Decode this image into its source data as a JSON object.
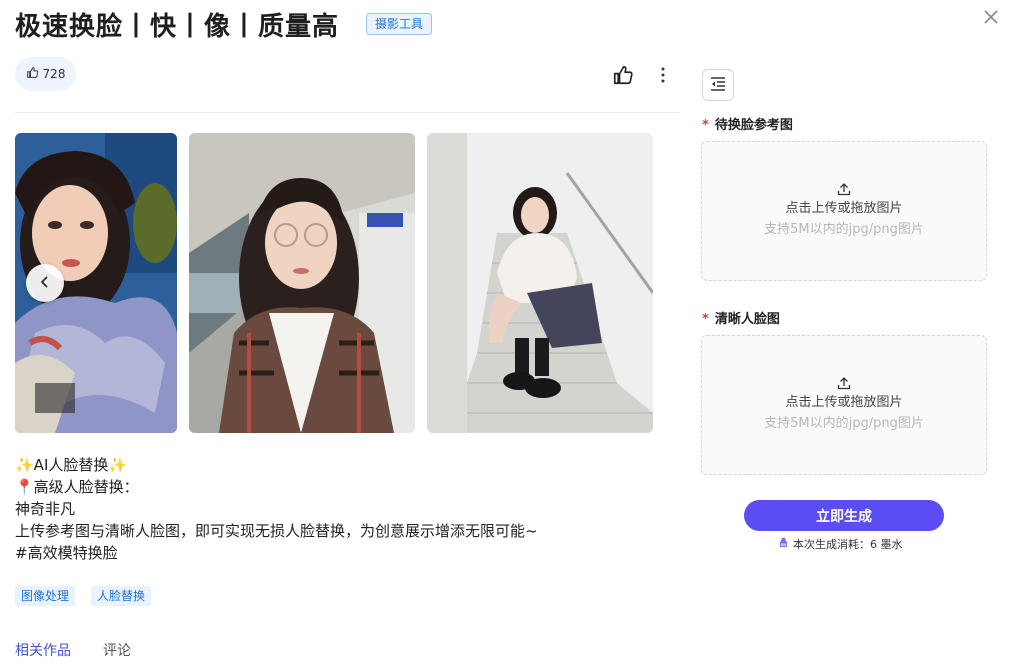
{
  "header": {
    "title": "极速换脸丨快丨像丨质量高",
    "tag": "摄影工具"
  },
  "stats": {
    "likes": "728"
  },
  "gallery": {
    "images": [
      {
        "alt": "girl-portrait-colorful"
      },
      {
        "alt": "girl-glasses-subway"
      },
      {
        "alt": "girl-sitting-stairs"
      }
    ]
  },
  "description": {
    "lines": [
      "✨AI人脸替换✨",
      "📍高级人脸替换：",
      "神奇非凡",
      "上传参考图与清晰人脸图，即可实现无损人脸替换，为创意展示增添无限可能~",
      "#高效模特换脸"
    ]
  },
  "tags": [
    "图像处理",
    "人脸替换"
  ],
  "tabs": [
    "相关作品",
    "评论"
  ],
  "form": {
    "field1": {
      "label": "待换脸参考图",
      "upload_text": "点击上传或拖放图片",
      "hint": "支持5M以内的jpg/png图片"
    },
    "field2": {
      "label": "清晰人脸图",
      "upload_text": "点击上传或拖放图片",
      "hint": "支持5M以内的jpg/png图片"
    },
    "required_mark": "*",
    "generate_label": "立即生成",
    "cost_text": "本次生成消耗：6 墨水"
  },
  "colors": {
    "accent": "#5b4df3",
    "tag_blue": "#1e73d8",
    "required": "#e53935"
  }
}
